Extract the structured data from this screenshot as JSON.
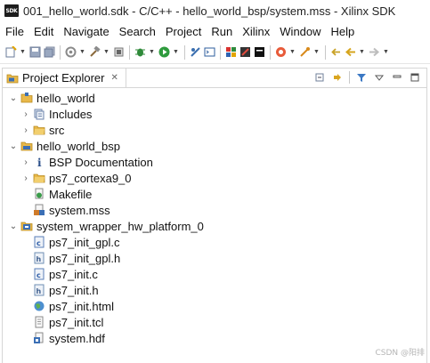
{
  "window": {
    "app_icon_text": "SDK",
    "title": "001_hello_world.sdk - C/C++ - hello_world_bsp/system.mss - Xilinx SDK"
  },
  "menu": [
    "File",
    "Edit",
    "Navigate",
    "Search",
    "Project",
    "Run",
    "Xilinx",
    "Window",
    "Help"
  ],
  "view": {
    "title": "Project Explorer",
    "close_glyph": "✕"
  },
  "tree": {
    "hello_world": "hello_world",
    "includes": "Includes",
    "src": "src",
    "hello_world_bsp": "hello_world_bsp",
    "bsp_documentation": "BSP Documentation",
    "ps7_cortexa9_0": "ps7_cortexa9_0",
    "makefile": "Makefile",
    "system_mss": "system.mss",
    "system_wrapper_hw_platform_0": "system_wrapper_hw_platform_0",
    "ps7_init_gpl_c": "ps7_init_gpl.c",
    "ps7_init_gpl_h": "ps7_init_gpl.h",
    "ps7_init_c": "ps7_init.c",
    "ps7_init_h": "ps7_init.h",
    "ps7_init_html": "ps7_init.html",
    "ps7_init_tcl": "ps7_init.tcl",
    "system_hdf": "system.hdf"
  },
  "twisty": {
    "expanded": "⌄",
    "collapsed": "›"
  },
  "watermark": "CSDN @阳排",
  "colors": {
    "folder": "#e8b84a",
    "project_blue": "#3b6fb5",
    "file_c": "#5a7fb8",
    "file_h": "#6f8fb3"
  }
}
